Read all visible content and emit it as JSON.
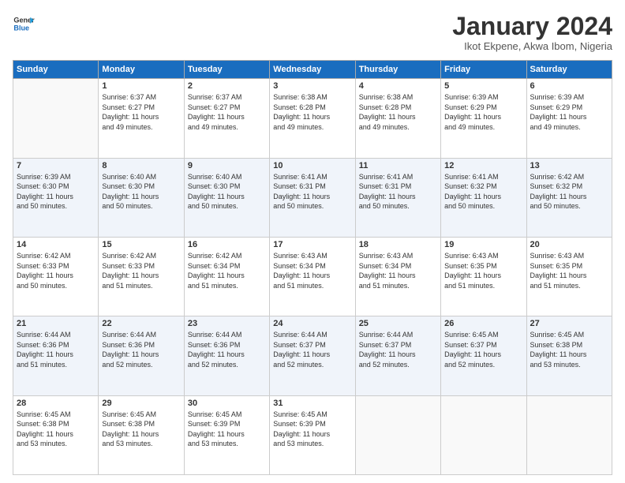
{
  "logo": {
    "line1": "General",
    "line2": "Blue"
  },
  "title": "January 2024",
  "location": "Ikot Ekpene, Akwa Ibom, Nigeria",
  "days_of_week": [
    "Sunday",
    "Monday",
    "Tuesday",
    "Wednesday",
    "Thursday",
    "Friday",
    "Saturday"
  ],
  "weeks": [
    [
      {
        "day": "",
        "content": ""
      },
      {
        "day": "1",
        "content": "Sunrise: 6:37 AM\nSunset: 6:27 PM\nDaylight: 11 hours\nand 49 minutes."
      },
      {
        "day": "2",
        "content": "Sunrise: 6:37 AM\nSunset: 6:27 PM\nDaylight: 11 hours\nand 49 minutes."
      },
      {
        "day": "3",
        "content": "Sunrise: 6:38 AM\nSunset: 6:28 PM\nDaylight: 11 hours\nand 49 minutes."
      },
      {
        "day": "4",
        "content": "Sunrise: 6:38 AM\nSunset: 6:28 PM\nDaylight: 11 hours\nand 49 minutes."
      },
      {
        "day": "5",
        "content": "Sunrise: 6:39 AM\nSunset: 6:29 PM\nDaylight: 11 hours\nand 49 minutes."
      },
      {
        "day": "6",
        "content": "Sunrise: 6:39 AM\nSunset: 6:29 PM\nDaylight: 11 hours\nand 49 minutes."
      }
    ],
    [
      {
        "day": "7",
        "content": "Sunrise: 6:39 AM\nSunset: 6:30 PM\nDaylight: 11 hours\nand 50 minutes."
      },
      {
        "day": "8",
        "content": "Sunrise: 6:40 AM\nSunset: 6:30 PM\nDaylight: 11 hours\nand 50 minutes."
      },
      {
        "day": "9",
        "content": "Sunrise: 6:40 AM\nSunset: 6:30 PM\nDaylight: 11 hours\nand 50 minutes."
      },
      {
        "day": "10",
        "content": "Sunrise: 6:41 AM\nSunset: 6:31 PM\nDaylight: 11 hours\nand 50 minutes."
      },
      {
        "day": "11",
        "content": "Sunrise: 6:41 AM\nSunset: 6:31 PM\nDaylight: 11 hours\nand 50 minutes."
      },
      {
        "day": "12",
        "content": "Sunrise: 6:41 AM\nSunset: 6:32 PM\nDaylight: 11 hours\nand 50 minutes."
      },
      {
        "day": "13",
        "content": "Sunrise: 6:42 AM\nSunset: 6:32 PM\nDaylight: 11 hours\nand 50 minutes."
      }
    ],
    [
      {
        "day": "14",
        "content": "Sunrise: 6:42 AM\nSunset: 6:33 PM\nDaylight: 11 hours\nand 50 minutes."
      },
      {
        "day": "15",
        "content": "Sunrise: 6:42 AM\nSunset: 6:33 PM\nDaylight: 11 hours\nand 51 minutes."
      },
      {
        "day": "16",
        "content": "Sunrise: 6:42 AM\nSunset: 6:34 PM\nDaylight: 11 hours\nand 51 minutes."
      },
      {
        "day": "17",
        "content": "Sunrise: 6:43 AM\nSunset: 6:34 PM\nDaylight: 11 hours\nand 51 minutes."
      },
      {
        "day": "18",
        "content": "Sunrise: 6:43 AM\nSunset: 6:34 PM\nDaylight: 11 hours\nand 51 minutes."
      },
      {
        "day": "19",
        "content": "Sunrise: 6:43 AM\nSunset: 6:35 PM\nDaylight: 11 hours\nand 51 minutes."
      },
      {
        "day": "20",
        "content": "Sunrise: 6:43 AM\nSunset: 6:35 PM\nDaylight: 11 hours\nand 51 minutes."
      }
    ],
    [
      {
        "day": "21",
        "content": "Sunrise: 6:44 AM\nSunset: 6:36 PM\nDaylight: 11 hours\nand 51 minutes."
      },
      {
        "day": "22",
        "content": "Sunrise: 6:44 AM\nSunset: 6:36 PM\nDaylight: 11 hours\nand 52 minutes."
      },
      {
        "day": "23",
        "content": "Sunrise: 6:44 AM\nSunset: 6:36 PM\nDaylight: 11 hours\nand 52 minutes."
      },
      {
        "day": "24",
        "content": "Sunrise: 6:44 AM\nSunset: 6:37 PM\nDaylight: 11 hours\nand 52 minutes."
      },
      {
        "day": "25",
        "content": "Sunrise: 6:44 AM\nSunset: 6:37 PM\nDaylight: 11 hours\nand 52 minutes."
      },
      {
        "day": "26",
        "content": "Sunrise: 6:45 AM\nSunset: 6:37 PM\nDaylight: 11 hours\nand 52 minutes."
      },
      {
        "day": "27",
        "content": "Sunrise: 6:45 AM\nSunset: 6:38 PM\nDaylight: 11 hours\nand 53 minutes."
      }
    ],
    [
      {
        "day": "28",
        "content": "Sunrise: 6:45 AM\nSunset: 6:38 PM\nDaylight: 11 hours\nand 53 minutes."
      },
      {
        "day": "29",
        "content": "Sunrise: 6:45 AM\nSunset: 6:38 PM\nDaylight: 11 hours\nand 53 minutes."
      },
      {
        "day": "30",
        "content": "Sunrise: 6:45 AM\nSunset: 6:39 PM\nDaylight: 11 hours\nand 53 minutes."
      },
      {
        "day": "31",
        "content": "Sunrise: 6:45 AM\nSunset: 6:39 PM\nDaylight: 11 hours\nand 53 minutes."
      },
      {
        "day": "",
        "content": ""
      },
      {
        "day": "",
        "content": ""
      },
      {
        "day": "",
        "content": ""
      }
    ]
  ]
}
